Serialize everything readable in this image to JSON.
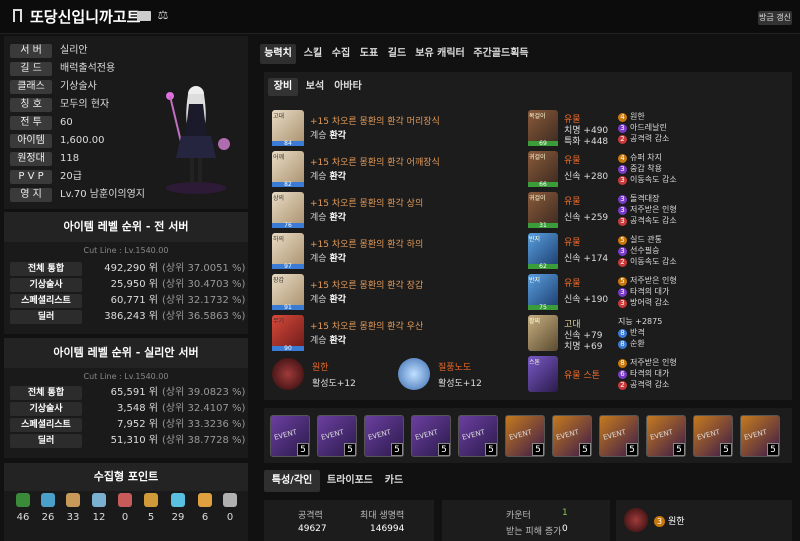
{
  "header": {
    "title": "또당신입니까고트",
    "refresh_label": "방금 갱신"
  },
  "profile": {
    "rows": [
      {
        "label": "서 버",
        "value": "실리안"
      },
      {
        "label": "길 드",
        "value": "배럭출석전용"
      },
      {
        "label": "클래스",
        "value": "기상술사"
      },
      {
        "label": "칭 호",
        "value": "모두의 현자"
      },
      {
        "label": "전 투",
        "value": "60"
      },
      {
        "label": "아이템",
        "value": "1,600.00"
      },
      {
        "label": "원정대",
        "value": "118"
      },
      {
        "label": "P V P",
        "value": "20급"
      },
      {
        "label": "영 지",
        "value": "Lv.70 남훈이의영지"
      }
    ]
  },
  "rank_all": {
    "title": "아이템 레벨 순위 - 전 서버",
    "cutline": "Cut Line : Lv.1540.00",
    "rows": [
      {
        "label": "전체 통합",
        "value": "492,290 위",
        "pct": "(상위  37.0051 %)"
      },
      {
        "label": "기상술사",
        "value": "25,950 위",
        "pct": "(상위  30.4703 %)"
      },
      {
        "label": "스페셜리스트",
        "value": "60,771 위",
        "pct": "(상위  32.1732 %)"
      },
      {
        "label": "딜러",
        "value": "386,243 위",
        "pct": "(상위  36.5863 %)"
      }
    ]
  },
  "rank_server": {
    "title": "아이템 레벨 순위 - 실리안 서버",
    "cutline": "Cut Line : Lv.1540.00",
    "rows": [
      {
        "label": "전체 통합",
        "value": "65,591 위",
        "pct": "(상위  39.0823 %)"
      },
      {
        "label": "기상술사",
        "value": "3,548 위",
        "pct": "(상위  32.4107 %)"
      },
      {
        "label": "스페셜리스트",
        "value": "7,952 위",
        "pct": "(상위  33.3236 %)"
      },
      {
        "label": "딜러",
        "value": "51,310 위",
        "pct": "(상위  38.7728 %)"
      }
    ]
  },
  "collection": {
    "title": "수집형 포인트",
    "items": [
      {
        "icon": "seed-icon",
        "value": "46",
        "color": "#3a8a3a"
      },
      {
        "icon": "island-heart-icon",
        "value": "26",
        "color": "#4aa0c8"
      },
      {
        "icon": "art-icon",
        "value": "33",
        "color": "#c89a5a"
      },
      {
        "icon": "sailor-icon",
        "value": "12",
        "color": "#7ab0d0"
      },
      {
        "icon": "giant-heart-icon",
        "value": "0",
        "color": "#c85a5a"
      },
      {
        "icon": "ignea-icon",
        "value": "5",
        "color": "#d09a3a"
      },
      {
        "icon": "orpeus-star-icon",
        "value": "29",
        "color": "#5ac0e0"
      },
      {
        "icon": "world-tree-leaf-icon",
        "value": "6",
        "color": "#e0a040"
      },
      {
        "icon": "mokoko-icon",
        "value": "0",
        "color": "#b0b0b0"
      }
    ]
  },
  "main_tabs": [
    "능력치",
    "스킬",
    "수집",
    "도표",
    "길드",
    "보유 캐릭터",
    "주간골드획득"
  ],
  "sub_tabs": [
    "장비",
    "보석",
    "아바타"
  ],
  "equipment": [
    {
      "tag": "고대",
      "quality": "84",
      "name": "+15 차오른 몽환의 환각 머리장식",
      "set_label": "계승",
      "set_value": "환각"
    },
    {
      "tag": "어깨",
      "quality": "82",
      "name": "+15 차오른 몽환의 환각 어깨장식",
      "set_label": "계승",
      "set_value": "환각"
    },
    {
      "tag": "상의",
      "quality": "76",
      "name": "+15 차오른 몽환의 환각 상의",
      "set_label": "계승",
      "set_value": "환각"
    },
    {
      "tag": "하의",
      "quality": "97",
      "name": "+15 차오른 몽환의 환각 하의",
      "set_label": "계승",
      "set_value": "환각"
    },
    {
      "tag": "장갑",
      "quality": "91",
      "name": "+15 차오른 몽환의 환각 장갑",
      "set_label": "계승",
      "set_value": "환각"
    },
    {
      "tag": "무기",
      "quality": "90",
      "name": "+15 차오른 몽환의 환각 우산",
      "set_label": "계승",
      "set_value": "환각"
    }
  ],
  "accessories": [
    {
      "tag": "목걸이",
      "quality": "69",
      "grade": "유물",
      "stats": [
        "치명 +490",
        "특화 +448"
      ],
      "engravings": [
        {
          "n": "4",
          "name": "원한",
          "color": "#c8780a"
        },
        {
          "n": "3",
          "name": "아드레날린",
          "color": "#7a3ac8"
        },
        {
          "n": "2",
          "name": "공격력 감소",
          "color": "#c83a3a"
        }
      ]
    },
    {
      "tag": "귀걸이",
      "quality": "66",
      "grade": "유물",
      "stats": [
        "신속 +280"
      ],
      "engravings": [
        {
          "n": "4",
          "name": "슈퍼 차지",
          "color": "#c8780a"
        },
        {
          "n": "3",
          "name": "중갑 착용",
          "color": "#7a3ac8"
        },
        {
          "n": "3",
          "name": "이동속도 감소",
          "color": "#c83a3a"
        }
      ]
    },
    {
      "tag": "귀걸이",
      "quality": "31",
      "grade": "유물",
      "stats": [
        "신속 +259"
      ],
      "engravings": [
        {
          "n": "3",
          "name": "돌격대장",
          "color": "#7a3ac8"
        },
        {
          "n": "3",
          "name": "저주받은 인형",
          "color": "#7a3ac8"
        },
        {
          "n": "3",
          "name": "공격속도 감소",
          "color": "#c83a3a"
        }
      ]
    },
    {
      "tag": "반지",
      "quality": "62",
      "grade": "유물",
      "stats": [
        "신속 +174"
      ],
      "engravings": [
        {
          "n": "5",
          "name": "실드 관통",
          "color": "#c8780a"
        },
        {
          "n": "3",
          "name": "선수필승",
          "color": "#7a3ac8"
        },
        {
          "n": "2",
          "name": "이동속도 감소",
          "color": "#c83a3a"
        }
      ]
    },
    {
      "tag": "반지",
      "quality": "75",
      "grade": "유물",
      "stats": [
        "신속 +190"
      ],
      "engravings": [
        {
          "n": "5",
          "name": "저주받은 인형",
          "color": "#c8780a"
        },
        {
          "n": "3",
          "name": "타격의 대가",
          "color": "#7a3ac8"
        },
        {
          "n": "3",
          "name": "방어력 감소",
          "color": "#c83a3a"
        }
      ]
    },
    {
      "tag": "팔찌",
      "quality": "",
      "grade": "고대",
      "stats": [
        "신속 +79",
        "치명 +69"
      ],
      "engravings": [
        {
          "n": "",
          "name": "지능 +2875",
          "color": ""
        },
        {
          "n": "8",
          "name": "반격",
          "color": "#3a7ad5"
        },
        {
          "n": "8",
          "name": "순환",
          "color": "#3a7ad5"
        }
      ]
    },
    {
      "tag": "스톤",
      "quality": "",
      "grade": "유물 스톤",
      "stats": [],
      "engravings": [
        {
          "n": "8",
          "name": "저주받은 인형",
          "color": "#c8780a"
        },
        {
          "n": "6",
          "name": "타격의 대가",
          "color": "#7a3ac8"
        },
        {
          "n": "2",
          "name": "공격력 감소",
          "color": "#c83a3a"
        }
      ]
    }
  ],
  "elixir": {
    "name": "원한",
    "value": "활성도+12"
  },
  "transcend": {
    "name": "질풍노도",
    "value": "활성도+12"
  },
  "gems": {
    "label": "EVENT",
    "levels": [
      "5",
      "5",
      "5",
      "5",
      "5",
      "5",
      "5",
      "5",
      "5",
      "5",
      "5"
    ]
  },
  "bottom_tabs": [
    "특성/각인",
    "트라이포드",
    "카드"
  ],
  "stats": {
    "attack_label": "공격력",
    "attack_value": "49627",
    "hp_label": "최대 생명력",
    "hp_value": "146994",
    "counter_label": "카운터",
    "counter_value": "1",
    "dmg_label": "받는 피해 증가",
    "dmg_value": "0",
    "engraving_n": "3",
    "engraving_name": "원한"
  }
}
